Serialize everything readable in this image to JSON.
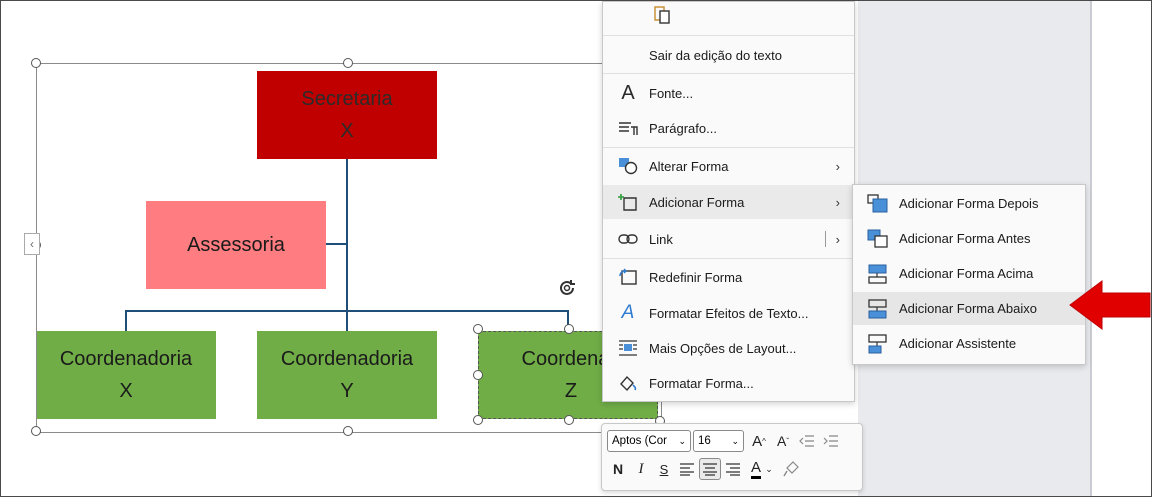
{
  "org_chart": {
    "secretaria": "Secretaria\nX",
    "assessoria": "Assessoria",
    "coord_x": "Coordenadoria\nX",
    "coord_y": "Coordenadoria\nY",
    "coord_z": "Coordenad\nZ"
  },
  "context_menu": {
    "items": [
      {
        "label": "Sair da edição do texto"
      },
      {
        "label": "Fonte...",
        "icon": "font-icon"
      },
      {
        "label": "Parágrafo...",
        "icon": "paragraph-icon"
      },
      {
        "label": "Alterar Forma",
        "icon": "change-shape-icon"
      },
      {
        "label": "Adicionar Forma",
        "icon": "add-shape-icon"
      },
      {
        "label": "Link",
        "icon": "link-icon"
      },
      {
        "label": "Redefinir Forma",
        "icon": "reset-shape-icon"
      },
      {
        "label": "Formatar Efeitos de Texto...",
        "icon": "text-effects-icon"
      },
      {
        "label": "Mais Opções de Layout...",
        "icon": "layout-options-icon"
      },
      {
        "label": "Formatar Forma...",
        "icon": "format-shape-icon"
      }
    ]
  },
  "submenu": {
    "items": [
      {
        "label": "Adicionar Forma Depois"
      },
      {
        "label": "Adicionar Forma Antes"
      },
      {
        "label": "Adicionar Forma Acima"
      },
      {
        "label": "Adicionar Forma Abaixo"
      },
      {
        "label": "Adicionar Assistente"
      }
    ]
  },
  "mini_toolbar": {
    "font_name": "Aptos (Cor",
    "font_size": "16",
    "bold": "N",
    "italic": "I",
    "strike": "S"
  },
  "colors": {
    "secretaria": "#c00000",
    "assessoria": "#ff7c80",
    "coordenadoria": "#70ad47",
    "connector": "#1f4e79",
    "arrow": "#e00000"
  }
}
